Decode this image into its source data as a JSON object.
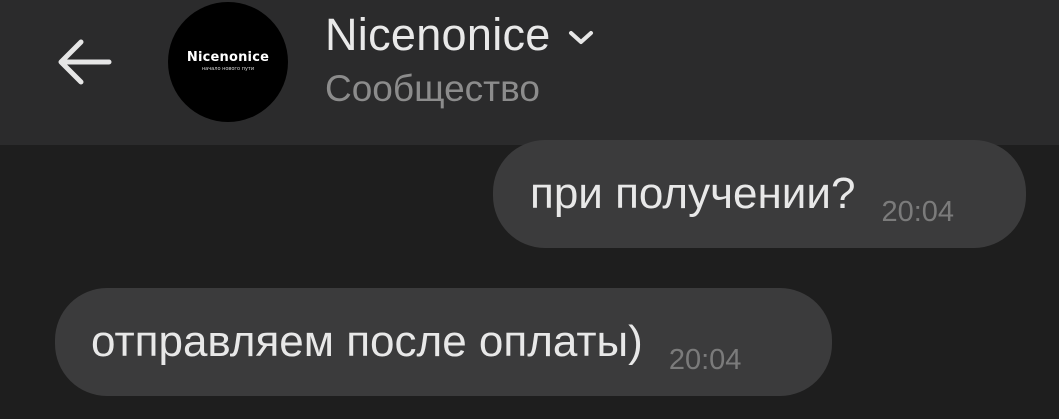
{
  "header": {
    "back_icon": "arrow-left-icon",
    "avatar": {
      "logo_text": "Nicenonice",
      "logo_tagline": "начало нового пути"
    },
    "title": "Nicenonice",
    "title_dropdown_icon": "chevron-down-icon",
    "subtitle": "Сообщество"
  },
  "messages": [
    {
      "direction": "outgoing",
      "text": "при получении?",
      "time": "20:04"
    },
    {
      "direction": "incoming",
      "text": "отправляем после оплаты)",
      "time": "20:04"
    }
  ],
  "colors": {
    "background": "#1e1e1e",
    "header": "#2b2b2c",
    "bubble": "#3b3b3c",
    "text": "#e8e8e8",
    "muted": "#8c8c8c"
  }
}
